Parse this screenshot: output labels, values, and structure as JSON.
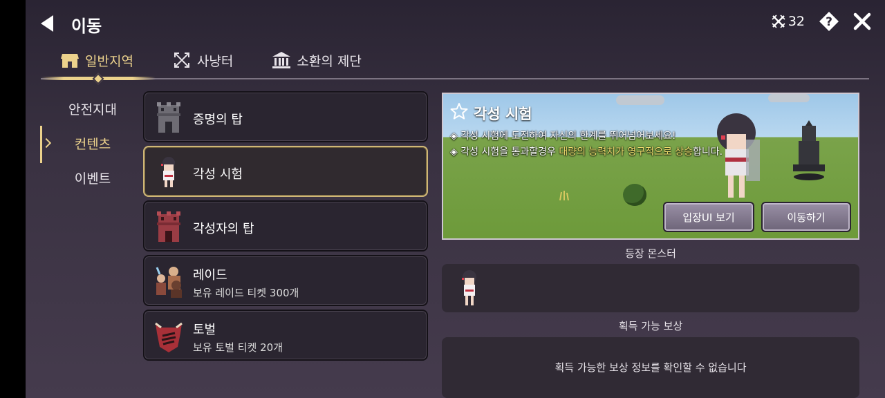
{
  "header": {
    "title": "이동",
    "ticket_count": "32"
  },
  "tabs": [
    {
      "label": "일반지역",
      "icon": "shop-icon",
      "active": true
    },
    {
      "label": "사냥터",
      "icon": "crossed-arrows-icon",
      "active": false
    },
    {
      "label": "소환의 제단",
      "icon": "temple-icon",
      "active": false
    }
  ],
  "subnav": [
    {
      "label": "안전지대",
      "active": false
    },
    {
      "label": "컨텐츠",
      "active": true
    },
    {
      "label": "이벤트",
      "active": false
    }
  ],
  "contents": [
    {
      "name": "증명의 탑",
      "sub": "",
      "icon": "tower-gray-icon"
    },
    {
      "name": "각성 시험",
      "sub": "",
      "icon": "girl-character-icon",
      "selected": true
    },
    {
      "name": "각성자의 탑",
      "sub": "",
      "icon": "tower-red-icon"
    },
    {
      "name": "레이드",
      "sub": "보유 레이드 티켓 300개",
      "icon": "raid-party-icon"
    },
    {
      "name": "토벌",
      "sub": "보유 토벌 티켓 20개",
      "icon": "demon-shield-icon"
    }
  ],
  "preview": {
    "title": "각성 시험",
    "line1": "◈ 각성 시험에 도전하여 자신의 한계를 뛰어넘어보세요!",
    "line2_prefix": "◈ 각성 시험을 통과할경우 ",
    "line2_highlight": "대량의 능력치가 영구적으로 상승",
    "line2_suffix": "합니다.",
    "enter_button": "입장UI 보기",
    "move_button": "이동하기"
  },
  "monsters": {
    "label": "등장 몬스터"
  },
  "rewards": {
    "label": "획득 가능 보상",
    "message": "획득 가능한 보상 정보를 확인할 수 없습니다"
  },
  "colors": {
    "accent_gold": "#ecd28c",
    "highlight_yellow": "#f2df6e"
  }
}
